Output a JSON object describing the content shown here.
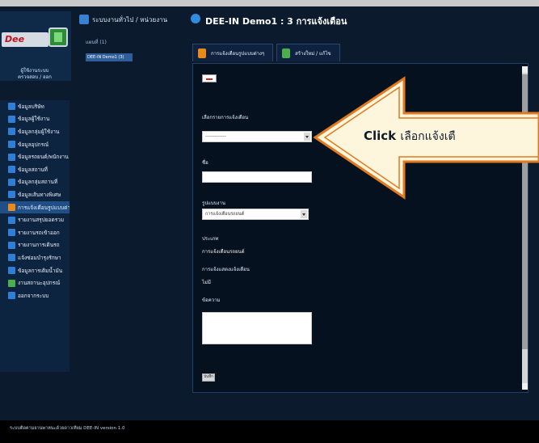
{
  "header": {
    "logo_text": "Dee",
    "user_info_line1": "ผู้ใช้งานระบบ",
    "user_info_line2": "ตรวจสอบ / ออก",
    "breadcrumb_text": "ระบบงานทั่วไป / หน่วยงาน",
    "breadcrumb_sub": "แผนที่ (1)",
    "demo_select": "DEE-IN Demo1 (3)",
    "page_title": "DEE-IN Demo1 : 3 การแจ้งเตือน"
  },
  "sidebar": {
    "items": [
      {
        "label": "ข้อมูลบริษัท",
        "color": "#2f7fd8"
      },
      {
        "label": "ข้อมูลผู้ใช้งาน",
        "color": "#2f7fd8"
      },
      {
        "label": "ข้อมูลกลุ่มผู้ใช้งาน",
        "color": "#2f7fd8"
      },
      {
        "label": "ข้อมูลอุปกรณ์",
        "color": "#2f7fd8"
      },
      {
        "label": "ข้อมูลรถยนต์/พนักงาน",
        "color": "#2f7fd8"
      },
      {
        "label": "ข้อมูลสถานที่",
        "color": "#2f7fd8"
      },
      {
        "label": "ข้อมูลกลุ่มสถานที่",
        "color": "#2f7fd8"
      },
      {
        "label": "ข้อมูลเส้นทางพิเศษ",
        "color": "#2f7fd8"
      },
      {
        "label": "การแจ้งเตือนรูปแบบต่างๆ",
        "color": "#e88a1a",
        "active": true
      },
      {
        "label": "รายงานสรุปยอดรวม",
        "color": "#2f7fd8"
      },
      {
        "label": "รายงานรถเข้าออก",
        "color": "#2f7fd8"
      },
      {
        "label": "รายงานการเดินรถ",
        "color": "#2f7fd8"
      },
      {
        "label": "แจ้งซ่อมบำรุงรักษา",
        "color": "#2f7fd8"
      },
      {
        "label": "ข้อมูลการเติมน้ำมัน",
        "color": "#2f7fd8"
      },
      {
        "label": "งานสถานะอุปกรณ์",
        "color": "#4bb04b"
      },
      {
        "label": "ออกจากระบบ",
        "color": "#2f7fd8"
      }
    ]
  },
  "tabs": [
    {
      "label": "การแจ้งเตือนรูปแบบต่างๆ",
      "color": "#e88a1a"
    },
    {
      "label": "สร้างใหม่ / แก้ไข",
      "color": "#4bb04b"
    }
  ],
  "form": {
    "label_alert_type": "เลือกรายการแจ้งเตือน",
    "alert_type_value": "-------------",
    "label_name": "ชื่อ",
    "name_value": "",
    "label_status": "รูปแบบงาน",
    "status_value": "การแจ้งเตือนรถยนต์",
    "label_type": "ประเภท",
    "type_value": "การแจ้งเตือนรถยนต์",
    "label_send_alert": "การแจ้งแสดงแจ้งเตือน",
    "send_alert_value": "ไม่มี",
    "label_note": "ข้อความ",
    "save_label": "บันทึก"
  },
  "callout": {
    "bold_text": "Click",
    "thai_text": "เลือกแจ้งเตื"
  },
  "footer": {
    "text": "ระบบติดตามยานพาหนะด้วยดาวเทียม DEE-IN version 1.0"
  }
}
